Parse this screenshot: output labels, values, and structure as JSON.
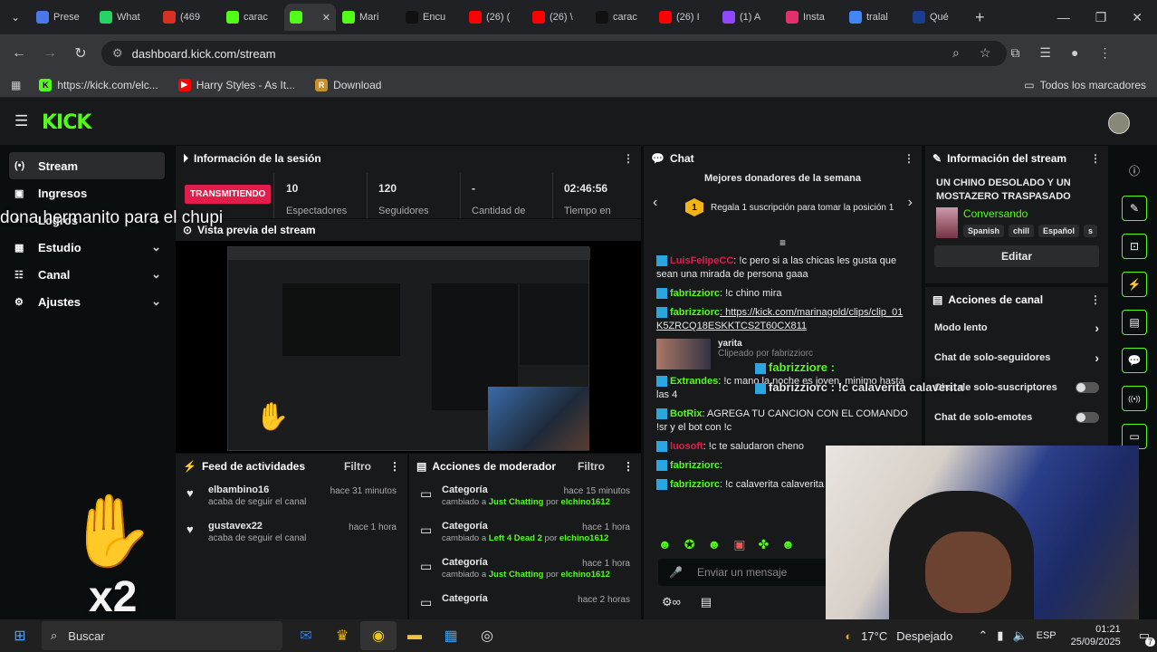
{
  "browser": {
    "tabs": [
      {
        "label": "Prese",
        "color": "#4a78e8"
      },
      {
        "label": "What",
        "color": "#25d366"
      },
      {
        "label": "(469",
        "color": "#d93025"
      },
      {
        "label": "carac",
        "color": "#53fc18"
      },
      {
        "label": "",
        "color": "#53fc18"
      },
      {
        "label": "Mari",
        "color": "#53fc18"
      },
      {
        "label": "Encu",
        "color": "#111111"
      },
      {
        "label": "(26) (",
        "color": "#ff0000"
      },
      {
        "label": "(26) \\",
        "color": "#ff0000"
      },
      {
        "label": "carac",
        "color": "#111111"
      },
      {
        "label": "(26) I",
        "color": "#ff0000"
      },
      {
        "label": "(1) A",
        "color": "#9146ff"
      },
      {
        "label": "Insta",
        "color": "#e1306c"
      },
      {
        "label": "tralal",
        "color": "#4285f4"
      },
      {
        "label": "Qué",
        "color": "#1a3d8f"
      }
    ],
    "url": "dashboard.kick.com/stream",
    "bookmarks": [
      "https://kick.com/elc...",
      "Harry Styles - As It...",
      "Download"
    ],
    "all_bookmarks": "Todos los marcadores"
  },
  "sidebar": {
    "items": [
      {
        "label": "Stream",
        "icon": "(•)"
      },
      {
        "label": "Ingresos",
        "icon": "▣"
      },
      {
        "label": "Logros",
        "icon": "♦"
      },
      {
        "label": "Estudio",
        "icon": "▦"
      },
      {
        "label": "Canal",
        "icon": "☷"
      },
      {
        "label": "Ajustes",
        "icon": "⚙"
      }
    ]
  },
  "overlay_text": "dona hermanito para el chupi",
  "session": {
    "title": "Información de la sesión",
    "status": "TRANSMITIENDO",
    "stats": [
      {
        "value": "10",
        "label": "Espectadores"
      },
      {
        "value": "120",
        "label": "Seguidores"
      },
      {
        "value": "-",
        "label": "Cantidad de"
      },
      {
        "value": "02:46:56",
        "label": "Tiempo en"
      }
    ],
    "preview_title": "Vista previa del stream"
  },
  "feed": {
    "title": "Feed de actividades",
    "filter": "Filtro",
    "items": [
      {
        "user": "elbambino16",
        "action": "acaba de seguir el canal",
        "time": "hace 31 minutos"
      },
      {
        "user": "gustavex22",
        "action": "acaba de seguir el canal",
        "time": "hace 1 hora"
      }
    ]
  },
  "mod": {
    "title": "Acciones de moderador",
    "filter": "Filtro",
    "items": [
      {
        "title": "Categoría",
        "pre": "cambiado a ",
        "cat": "Just Chatting",
        "by": " por ",
        "user": "elchino1612",
        "time": "hace 15 minutos"
      },
      {
        "title": "Categoría",
        "pre": "cambiado a ",
        "cat": "Left 4 Dead 2",
        "by": " por ",
        "user": "elchino1612",
        "time": "hace 1 hora"
      },
      {
        "title": "Categoría",
        "pre": "cambiado a ",
        "cat": "Just Chatting",
        "by": " por ",
        "user": "elchino1612",
        "time": "hace 1 hora"
      },
      {
        "title": "Categoría",
        "pre": "",
        "cat": "",
        "by": "",
        "user": "",
        "time": "hace 2 horas"
      }
    ]
  },
  "chat": {
    "title": "Chat",
    "donors_title": "Mejores donadores de la semana",
    "donor_rank": "1",
    "donor_text": "Regala 1 suscripción para tomar la posición 1",
    "messages": [
      {
        "user": "LuisFelipeCC",
        "text": ": !c pero si a las chicas les gusta que sean una mirada de persona gaaa",
        "color": "#e01d4b"
      },
      {
        "user": "fabrizziorc",
        "text": ": !c chino mira",
        "color": "#53fc18"
      },
      {
        "user": "fabrizziorc",
        "text": ": https://kick.com/marinagold/clips/clip_01K5ZRCQ18ESKKTCS2T60CX811",
        "color": "#53fc18"
      },
      {
        "user": "Extrandes",
        "text": ": !c mano la noche es joven, minimo hasta las 4",
        "color": "#53fc18"
      },
      {
        "user": "BotRix",
        "text": ": AGREGA TU CANCION CON EL COMANDO !sr y el bot con !c",
        "color": "#53fc18"
      },
      {
        "user": "luosoft",
        "text": ": !c te saludaron cheno",
        "color": "#e01d4b"
      },
      {
        "user": "fabrizziorc",
        "text": ":",
        "color": "#53fc18"
      },
      {
        "user": "fabrizziorc",
        "text": ": !c calaverita calaverita",
        "color": "#53fc18"
      }
    ],
    "clip_user": "yarita",
    "clip_text": "Clipeado por fabrizziorc",
    "popup1": "fabrizziore :",
    "popup2": "fabrizziorc : !c calaverita calaverita",
    "input_placeholder": "Enviar un mensaje"
  },
  "stream_info": {
    "title": "Información del stream",
    "stream_title": "UN CHINO DESOLADO Y UN MOSTAZERO TRASPASADO",
    "category": "Conversando",
    "tags": [
      "Spanish",
      "chill",
      "Español",
      "s"
    ],
    "edit": "Editar"
  },
  "actions": {
    "title": "Acciones de canal",
    "items": [
      {
        "label": "Modo lento",
        "control": "chevron"
      },
      {
        "label": "Chat de solo-seguidores",
        "control": "chevron"
      },
      {
        "label": "Chat de solo-suscriptores",
        "control": "toggle"
      },
      {
        "label": "Chat de solo-emotes",
        "control": "toggle"
      }
    ]
  },
  "rail": [
    "info-icon",
    "pencil-icon",
    "camera-icon",
    "bolt-icon",
    "note-icon",
    "chat-icon",
    "broadcast-icon",
    "card-icon"
  ],
  "overlay_badge": "x2",
  "taskbar": {
    "search": "Buscar",
    "temp": "17°C",
    "weather": "Despejado",
    "lang": "ESP",
    "time": "01:21",
    "date": "25/09/2025",
    "notif": "7"
  }
}
